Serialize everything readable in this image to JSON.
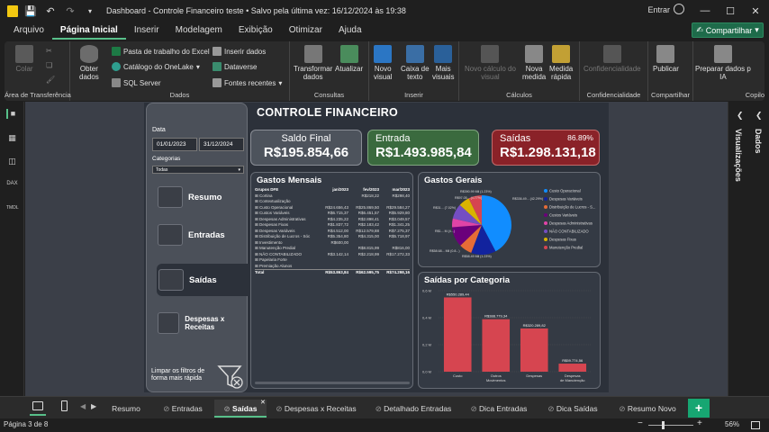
{
  "titlebar": {
    "title": "Dashboard - Controle Financeiro teste • Salvo pela última vez: 16/12/2024 às 19:38",
    "user": "Entrar"
  },
  "menu": {
    "items": [
      "Arquivo",
      "Página Inicial",
      "Inserir",
      "Modelagem",
      "Exibição",
      "Otimizar",
      "Ajuda"
    ],
    "share": "Compartilhar"
  },
  "ribbon": {
    "clipboard": {
      "label": "Área de Transferência",
      "colar": "Colar"
    },
    "data": {
      "label": "Dados",
      "obter": "Obter",
      "dados": "dados",
      "excel": "Pasta de trabalho do Excel",
      "onelake": "Catálogo do OneLake",
      "sql": "SQL Server",
      "inserir": "Inserir dados",
      "dataverse": "Dataverse",
      "fontes": "Fontes recentes"
    },
    "queries": {
      "label": "Consultas",
      "transformar": "Transformar",
      "dados": "dados",
      "atualizar": "Atualizar"
    },
    "insert": {
      "label": "Inserir",
      "novo": "Novo",
      "visual": "visual",
      "caixa": "Caixa de",
      "texto": "texto",
      "mais": "Mais",
      "visuais": "visuais"
    },
    "calc": {
      "label": "Cálculos",
      "novo_calc": "Novo cálculo do",
      "visual": "visual",
      "nova": "Nova",
      "medida": "medida",
      "medida2": "Medida",
      "rapida": "rápida"
    },
    "sens": {
      "label": "Confidencialidade",
      "btn": "Confidencialidade"
    },
    "share": {
      "label": "Compartilhar",
      "btn": "Publicar"
    },
    "copilot": {
      "label": "Copilo",
      "btn1": "Preparar dados p",
      "btn2": "IA"
    }
  },
  "panes": {
    "dados": "Dados",
    "visualizacoes": "Visualizações"
  },
  "report": {
    "title": "CONTROLE FINANCEIRO",
    "filters": {
      "data_label": "Data",
      "date_from": "01/01/2023",
      "date_to": "31/12/2024",
      "cat_label": "Categorias",
      "cat_value": "Todas"
    },
    "nav": [
      "Resumo",
      "Entradas",
      "Saídas",
      "Despesas x Receitas"
    ],
    "clear_filters": "Limpar os filtros de forma mais rápida",
    "cards": {
      "saldo": {
        "label": "Saldo Final",
        "value": "R$195.854,66"
      },
      "entrada": {
        "label": "Entrada",
        "value": "R$1.493.985,84"
      },
      "saidas": {
        "label": "Saídas",
        "value": "R$1.298.131,18",
        "pct": "86.89%"
      }
    },
    "gastos_mensais": {
      "title": "Gastos Mensais",
      "headers": [
        "Grupos DFE",
        "jan/2023",
        "fev/2023",
        "mar/2023"
      ],
      "rows": [
        [
          "Cortina",
          "",
          "R$218,22",
          "R$298,40"
        ],
        [
          "Contextualização",
          "",
          "",
          ""
        ],
        [
          "Custo Operacional",
          "R$24.656,43",
          "R$25.869,50",
          "R$29.584,27"
        ],
        [
          "Custos Variáveis",
          "R$6.715,37",
          "R$6.451,57",
          "R$5.929,80"
        ],
        [
          "Despesas Administrativas",
          "R$4.235,22",
          "R$2.898,41",
          "R$3.049,57"
        ],
        [
          "Despesas Fixas",
          "R$1.837,72",
          "R$2.183,42",
          "R$1.341,25"
        ],
        [
          "Despesas Variáveis",
          "R$4.512,00",
          "R$12.579,88",
          "R$7.275,37"
        ],
        [
          "Distribuição de Lucros - Sóc",
          "R$5.354,80",
          "R$4.315,00",
          "R$5.718,97"
        ],
        [
          "Investimento",
          "R$600,00",
          "",
          ""
        ],
        [
          "Manutenção Predial",
          "",
          "R$8.815,99",
          "R$816,00"
        ],
        [
          "NÃO CONTABILIZADO",
          "R$3.142,14",
          "R$2.218,99",
          "R$17.272,33"
        ],
        [
          "Papelaria Forte",
          "",
          "",
          ""
        ],
        [
          "Premiação Alunos",
          "",
          "",
          ""
        ]
      ],
      "total": [
        "Total",
        "R$53.863,84",
        "R$62.595,75",
        "R$74.298,16"
      ]
    },
    "gastos_gerais": {
      "title": "Gastos Gerais",
      "slice_labels": [
        "R$390.99 Mil (1.23%)",
        "R$97.05... (4.77%)",
        "R$31... (7.02%)",
        "R$1... M (4...)",
        "R$58.68... Mil (0.8...)",
        "R$58.49 Mil (1.23%)",
        "R$336.49... (42.29%)"
      ],
      "legend": [
        "Custo Operacional",
        "Despesas Variáveis",
        "Distribuição de Lucros - S...",
        "Custos Variáveis",
        "Despesas Administrativas",
        "NÃO CONTABILIZADO",
        "Despesas Fixas",
        "Manutenção Predial"
      ],
      "colors": [
        "#118dff",
        "#12239e",
        "#e66c37",
        "#6b007b",
        "#e044a7",
        "#744ec2",
        "#d9b300",
        "#d64550"
      ]
    },
    "saidas_categoria": {
      "title": "Saídas por Categoria",
      "yticks": [
        "0,6 M",
        "0,4 M",
        "0,2 M",
        "0,0 M"
      ]
    }
  },
  "chart_data": [
    {
      "type": "pie",
      "title": "Gastos Gerais",
      "categories": [
        "Custo Operacional",
        "Despesas Variáveis",
        "Distribuição de Lucros - S...",
        "Custos Variáveis",
        "Despesas Administrativas",
        "NÃO CONTABILIZADO",
        "Despesas Fixas",
        "Manutenção Predial"
      ],
      "values": [
        42.29,
        13.5,
        7.02,
        11.0,
        4.77,
        8.2,
        6.0,
        7.22
      ]
    },
    {
      "type": "bar",
      "title": "Saídas por Categoria",
      "categories": [
        "Custo",
        "Outros Movimentos",
        "Despesas",
        "Despesas de Manutenção"
      ],
      "values": [
        550.26,
        388.78,
        320.29,
        59.77
      ],
      "data_labels": [
        "R$550.289,44",
        "R$388.779,34",
        "R$320.289,82",
        "R$59.774,56"
      ],
      "ylim": [
        0,
        600
      ]
    }
  ],
  "pages": {
    "tabs": [
      "Resumo",
      "Entradas",
      "Saídas",
      "Despesas x Receitas",
      "Detalhado Entradas",
      "Dica Entradas",
      "Dica Saídas",
      "Resumo Novo"
    ],
    "active": "Saídas",
    "add": "+"
  },
  "status": {
    "page": "Página 3 de 8",
    "zoom": "56%"
  }
}
